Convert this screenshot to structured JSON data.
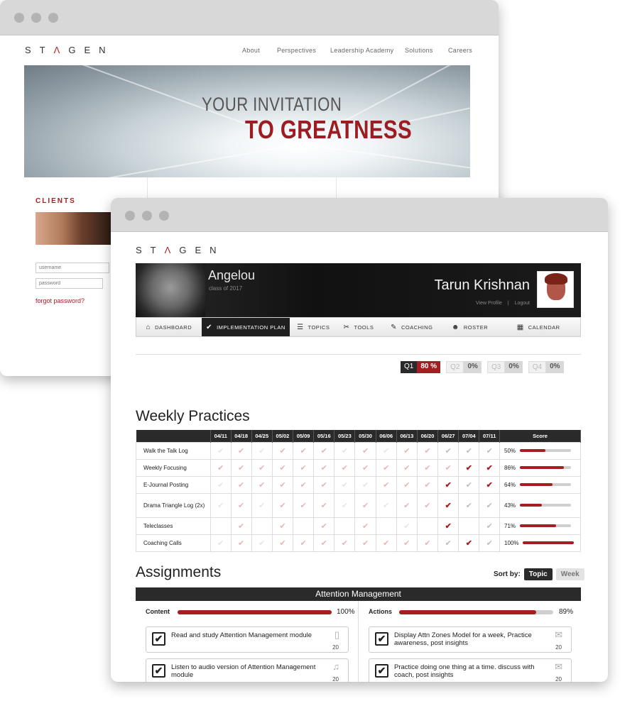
{
  "back_site": {
    "logo": [
      "S",
      "T",
      "Λ",
      "G",
      "E",
      "N"
    ],
    "nav": [
      "About",
      "Perspectives",
      "Leadership Academy",
      "Solutions",
      "Careers"
    ],
    "hero_line1": "YOUR INVITATION",
    "hero_line2": "TO GREATNESS",
    "clients_title": "CLIENTS",
    "username_placeholder": "username",
    "password_placeholder": "password",
    "forgot_link": "forgot password?"
  },
  "front_site": {
    "logo": [
      "S",
      "T",
      "Λ",
      "G",
      "E",
      "N"
    ],
    "banner": {
      "member_name": "Angelou",
      "member_class": "class of 2017",
      "user_name": "Tarun Krishnan",
      "view_profile": "View Profile",
      "divider": "|",
      "logout": "Logout"
    },
    "tabs": [
      {
        "label": "DASHBOARD",
        "icon": "home-icon",
        "glyph": "⌂",
        "active": false
      },
      {
        "label": "IMPLEMENTATION PLAN",
        "icon": "check-icon",
        "glyph": "✔",
        "active": true
      },
      {
        "label": "TOPICS",
        "icon": "list-icon",
        "glyph": "☰",
        "active": false
      },
      {
        "label": "TOOLS",
        "icon": "tools-icon",
        "glyph": "✂",
        "active": false
      },
      {
        "label": "COACHING",
        "icon": "whistle-icon",
        "glyph": "✎",
        "active": false
      },
      {
        "label": "ROSTER",
        "icon": "people-icon",
        "glyph": "☻",
        "active": false
      },
      {
        "label": "CALENDAR",
        "icon": "calendar-icon",
        "glyph": "▦",
        "active": false
      }
    ],
    "quarters": [
      {
        "label": "Q1",
        "value": "80 %",
        "active": true
      },
      {
        "label": "Q2",
        "value": "0%",
        "active": false
      },
      {
        "label": "Q3",
        "value": "0%",
        "active": false
      },
      {
        "label": "Q4",
        "value": "0%",
        "active": false
      }
    ],
    "weekly_title": "Weekly Practices",
    "weeks": [
      "04/11",
      "04/18",
      "04/25",
      "05/02",
      "05/09",
      "05/16",
      "05/23",
      "05/30",
      "06/06",
      "06/13",
      "06/20",
      "06/27",
      "07/04",
      "07/11"
    ],
    "score_header": "Score",
    "practices": [
      {
        "name": "Walk the Talk Log",
        "marks": "fpfpppfpfppggg",
        "score": "50%",
        "fill": 0.5
      },
      {
        "name": "Weekly Focusing",
        "marks": "ppppppppppppdd",
        "score": "86%",
        "fill": 0.86
      },
      {
        "name": "E-Journal Posting",
        "marks": "fpppppffpppdgd",
        "score": "64%",
        "fill": 0.64
      },
      {
        "name": "Drama Triangle Log (2x)",
        "marks": "fpfpppfpfppdgg",
        "score": "43%",
        "fill": 0.43
      },
      {
        "name": "Teleclasses",
        "marks": "-p-p-p-p-f-d-g",
        "score": "71%",
        "fill": 0.71
      },
      {
        "name": "Coaching Calls",
        "marks": "fpfppppppppgdg",
        "score": "100%",
        "fill": 1.0
      }
    ],
    "assignments_title": "Assignments",
    "sort_label": "Sort by:",
    "sort_topic": "Topic",
    "sort_week": "Week",
    "group_title": "Attention Management",
    "content_label": "Content",
    "content_pct": "100%",
    "content_fill": 1.0,
    "actions_label": "Actions",
    "actions_pct": "89%",
    "actions_fill": 0.89,
    "cards": [
      {
        "text": "Read and study Attention Management module",
        "icon": "document-icon",
        "glyph": "▯",
        "count": "20"
      },
      {
        "text": "Display Attn Zones Model for a week, Practice awareness, post insights",
        "icon": "mail-icon",
        "glyph": "✉",
        "count": "20"
      },
      {
        "text": "Listen to audio version of Attention Management module",
        "icon": "music-icon",
        "glyph": "♫",
        "count": "20"
      },
      {
        "text": "Practice doing one thing at a time. discuss with coach, post insights",
        "icon": "mail-icon",
        "glyph": "✉",
        "count": "20"
      }
    ],
    "check_glyph": "✔"
  }
}
